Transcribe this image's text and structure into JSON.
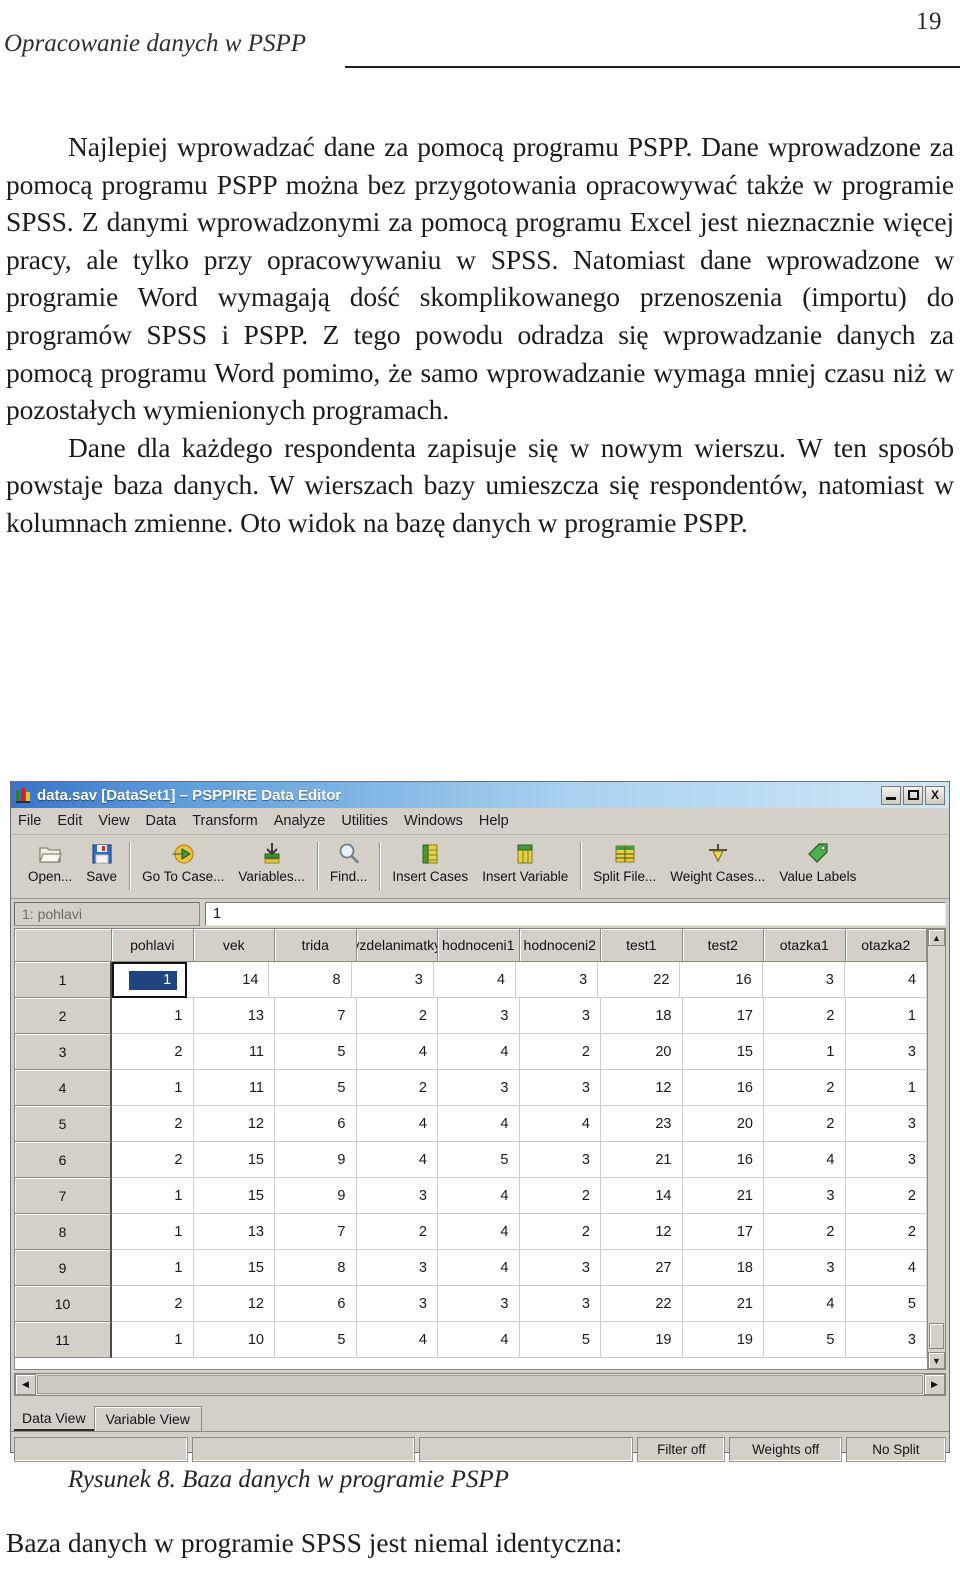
{
  "page": {
    "number": "19",
    "running_head": "Opracowanie danych w PSPP"
  },
  "body": {
    "paragraph_1": "Najlepiej wprowadzać dane za pomocą programu PSPP. Dane wprowadzone za pomocą programu PSPP można bez przygotowania opracowywać także w programie SPSS. Z danymi wprowadzonymi za pomocą programu Excel jest nieznacznie więcej pracy, ale tylko przy opracowywaniu w SPSS. Natomiast dane wprowadzone w programie Word wymagają dość skomplikowanego przenoszenia (importu) do programów SPSS i PSPP. Z tego powodu odradza się wprowadzanie danych za pomocą programu Word pomimo, że samo wprowadzanie wymaga mniej czasu niż w pozostałych wymienionych programach.",
    "paragraph_2": "Dane dla każdego respondenta zapisuje się w nowym wierszu. W ten sposób powstaje baza danych. W wierszach bazy umieszcza się respondentów, natomiast w kolumnach zmienne. Oto widok na bazę danych w programie PSPP.",
    "figure_caption": "Rysunek 8. Baza danych w programie PSPP",
    "trailing_line": "Baza danych w programie SPSS jest niemal identyczna:"
  },
  "pspp": {
    "titlebar": {
      "title": "data.sav [DataSet1] – PSPPIRE Data Editor",
      "minimize_label": "_",
      "maximize_label": "□",
      "close_label": "X"
    },
    "menus": [
      {
        "label": "File",
        "accel": "F"
      },
      {
        "label": "Edit",
        "accel": "E"
      },
      {
        "label": "View",
        "accel": "V"
      },
      {
        "label": "Data",
        "accel": "D"
      },
      {
        "label": "Transform",
        "accel": "T"
      },
      {
        "label": "Analyze",
        "accel": "A"
      },
      {
        "label": "Utilities",
        "accel": "U"
      },
      {
        "label": "Windows",
        "accel": "W"
      },
      {
        "label": "Help",
        "accel": "H"
      }
    ],
    "toolbar": [
      {
        "label": "Open...",
        "icon": "open-folder-icon"
      },
      {
        "label": "Save",
        "icon": "floppy-disk-icon"
      },
      {
        "sep": true
      },
      {
        "label": "Go To Case...",
        "icon": "goto-arrow-icon"
      },
      {
        "label": "Variables...",
        "icon": "variables-icon"
      },
      {
        "sep": true
      },
      {
        "label": "Find...",
        "icon": "magnifier-icon"
      },
      {
        "sep": true
      },
      {
        "label": "Insert Cases",
        "icon": "insert-cases-icon"
      },
      {
        "label": "Insert Variable",
        "icon": "insert-variable-icon"
      },
      {
        "sep": true
      },
      {
        "label": "Split File...",
        "icon": "split-file-icon"
      },
      {
        "label": "Weight Cases...",
        "icon": "weight-cases-icon"
      },
      {
        "label": "Value Labels",
        "icon": "value-labels-icon"
      }
    ],
    "cellbar": {
      "reference": "1: pohlavi",
      "value": "1"
    },
    "grid": {
      "columns": [
        "pohlavi",
        "vek",
        "trida",
        "vzdelanimatky",
        "hodnoceni1",
        "hodnoceni2",
        "test1",
        "test2",
        "otazka1",
        "otazka2"
      ],
      "row_labels": [
        "1",
        "2",
        "3",
        "4",
        "5",
        "6",
        "7",
        "8",
        "9",
        "10",
        "11"
      ],
      "rows": [
        [
          "1",
          "14",
          "8",
          "3",
          "4",
          "3",
          "22",
          "16",
          "3",
          "4"
        ],
        [
          "1",
          "13",
          "7",
          "2",
          "3",
          "3",
          "18",
          "17",
          "2",
          "1"
        ],
        [
          "2",
          "11",
          "5",
          "4",
          "4",
          "2",
          "20",
          "15",
          "1",
          "3"
        ],
        [
          "1",
          "11",
          "5",
          "2",
          "3",
          "3",
          "12",
          "16",
          "2",
          "1"
        ],
        [
          "2",
          "12",
          "6",
          "4",
          "4",
          "4",
          "23",
          "20",
          "2",
          "3"
        ],
        [
          "2",
          "15",
          "9",
          "4",
          "5",
          "3",
          "21",
          "16",
          "4",
          "3"
        ],
        [
          "1",
          "15",
          "9",
          "3",
          "4",
          "2",
          "14",
          "21",
          "3",
          "2"
        ],
        [
          "1",
          "13",
          "7",
          "2",
          "4",
          "2",
          "12",
          "17",
          "2",
          "2"
        ],
        [
          "1",
          "15",
          "8",
          "3",
          "4",
          "3",
          "27",
          "18",
          "3",
          "4"
        ],
        [
          "2",
          "12",
          "6",
          "3",
          "3",
          "3",
          "22",
          "21",
          "4",
          "5"
        ],
        [
          "1",
          "10",
          "5",
          "4",
          "4",
          "5",
          "19",
          "19",
          "5",
          "3"
        ]
      ],
      "selected_cell": {
        "row": 0,
        "col": 0,
        "value": "1"
      },
      "scroll_up_glyph": "▲",
      "scroll_down_glyph": "▼",
      "scroll_left_glyph": "◀",
      "scroll_right_glyph": "▶"
    },
    "tabs": [
      {
        "label": "Data View",
        "active": true
      },
      {
        "label": "Variable View",
        "active": false
      }
    ],
    "status": [
      "",
      "",
      "",
      "Filter off",
      "Weights off",
      "No Split"
    ],
    "colors": {
      "titlebar_start": "#3a73c8",
      "titlebar_end": "#cfe7f7",
      "chrome": "#d4d0c8",
      "selection": "#1f4480",
      "grid_line": "#cdcdcd"
    }
  }
}
